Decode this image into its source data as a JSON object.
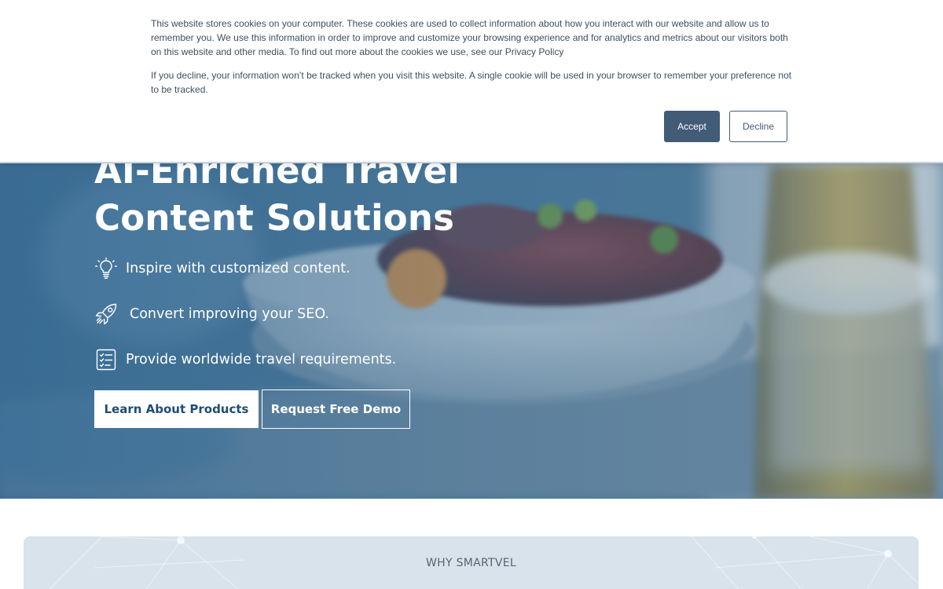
{
  "cookie_banner": {
    "paragraph_1": "This website stores cookies on your computer. These cookies are used to collect information about how you interact with our website and allow us to remember you. We use this information in order to improve and customize your browsing experience and for analytics and metrics about our visitors both on this website and other media. To find out more about the cookies we use, see our Privacy Policy",
    "paragraph_2": "If you decline, your information won’t be tracked when you visit this website. A single cookie will be used in your browser to remember your preference not to be tracked.",
    "accept_label": "Accept",
    "decline_label": "Decline"
  },
  "hero": {
    "title_line_1": "AI-Enriched Travel",
    "title_line_2": "Content Solutions",
    "features": [
      {
        "icon": "lightbulb-icon",
        "text": "Inspire with customized content."
      },
      {
        "icon": "rocket-icon",
        "text": "Convert improving your SEO."
      },
      {
        "icon": "checklist-icon",
        "text": "Provide worldwide travel requirements."
      }
    ],
    "primary_button": "Learn About Products",
    "secondary_button": "Request Free Demo"
  },
  "why_section": {
    "label": "WHY SMARTVEL"
  },
  "colors": {
    "banner_button": "#425b76",
    "hero_tint": "#4b7b9e",
    "primary_text": "#1e4d73",
    "why_background": "#d8e3ec"
  }
}
